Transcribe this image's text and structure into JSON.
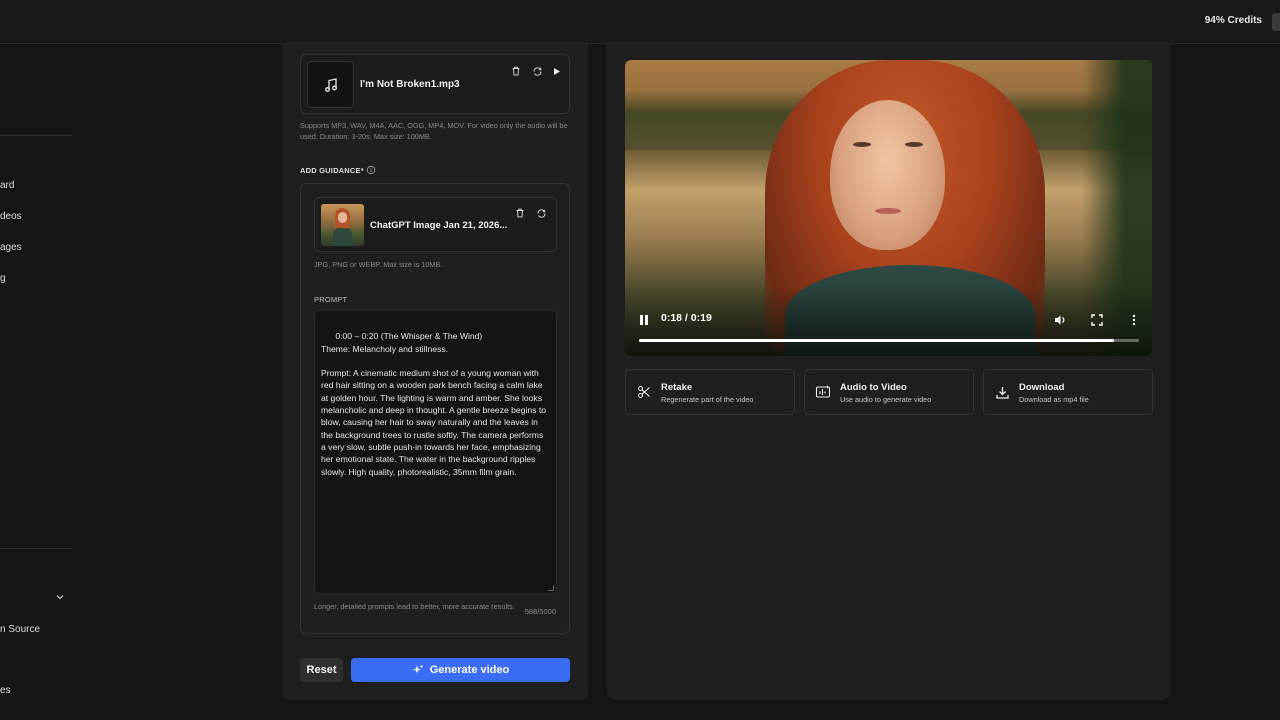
{
  "header": {
    "credits": "94% Credits"
  },
  "sidebar": {
    "items": [
      {
        "label": "ard"
      },
      {
        "label": "deos"
      },
      {
        "label": "ages"
      },
      {
        "label": "g"
      },
      {
        "label": "n Source"
      },
      {
        "label": "es"
      }
    ]
  },
  "audio": {
    "file_name": "I'm Not Broken1.mp3",
    "help": "Supports MP3, WAV, M4A, AAC, OGG, MP4, MOV. For video only the audio will be used. Duration: 3-20s. Max size: 100MB."
  },
  "guidance": {
    "label": "ADD GUIDANCE*",
    "image_name": "ChatGPT Image Jan 21, 2026...",
    "image_help": "JPG, PNG or WEBP. Max size is 10MB.",
    "prompt_label": "PROMPT",
    "prompt_text": "0:00 – 0:20 (The Whisper & The Wind)\nTheme: Melancholy and stillness.\n\nPrompt: A cinematic medium shot of a young woman with red hair sitting on a wooden park bench facing a calm lake at golden hour. The lighting is warm and amber. She looks melancholic and deep in thought. A gentle breeze begins to blow, causing her hair to sway naturally and the leaves in the background trees to rustle softly. The camera performs a very slow, subtle push-in towards her face, emphasizing her emotional state. The water in the background ripples slowly. High quality, photorealistic, 35mm film grain.",
    "prompt_hint": "Longer, detailed prompts lead to better, more accurate results.",
    "char_count": "588/5000"
  },
  "buttons": {
    "reset": "Reset",
    "generate": "Generate video"
  },
  "video": {
    "time": "0:18 / 0:19",
    "progress": 0.95
  },
  "actions": [
    {
      "title": "Retake",
      "subtitle": "Regenerate part of the video",
      "icon": "scissors-icon"
    },
    {
      "title": "Audio to Video",
      "subtitle": "Use audio to generate video",
      "icon": "audio-video-icon"
    },
    {
      "title": "Download",
      "subtitle": "Download as mp4 file",
      "icon": "download-icon"
    }
  ],
  "colors": {
    "accent": "#3b6cf5",
    "panel": "#1f1f1f",
    "background": "#151515"
  }
}
